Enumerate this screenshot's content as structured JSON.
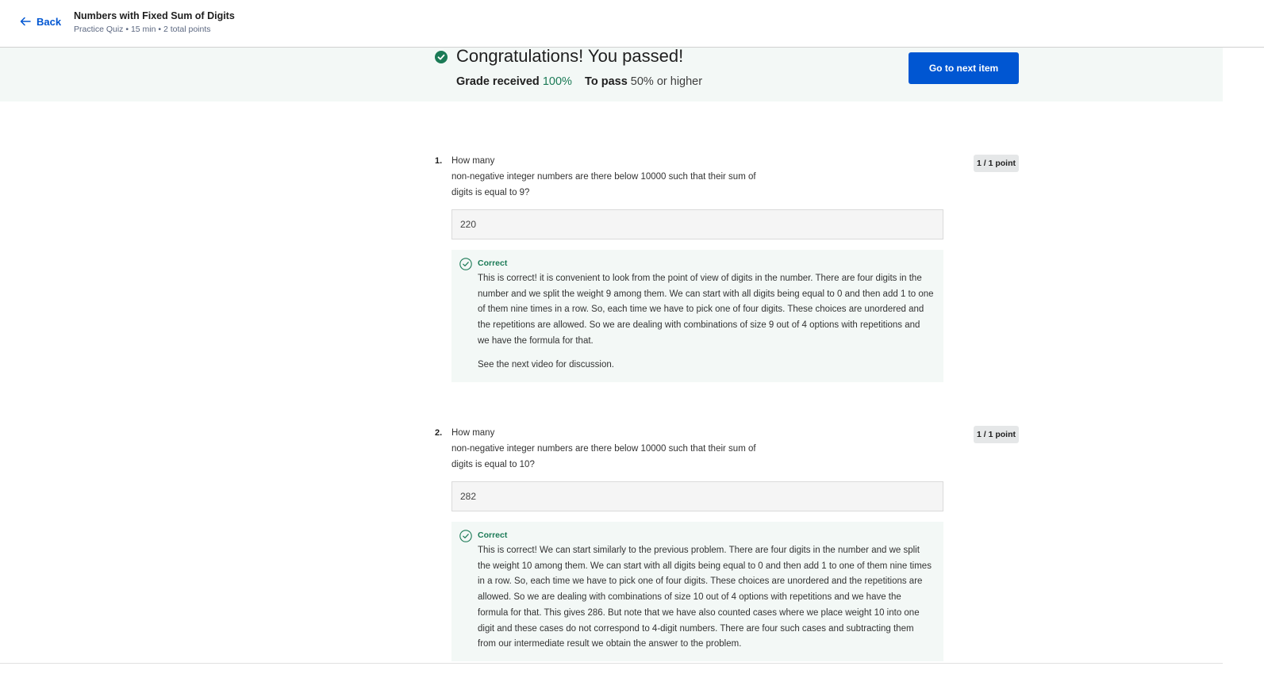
{
  "header": {
    "back_label": "Back",
    "title": "Numbers with Fixed Sum of Digits",
    "meta": "Practice Quiz • 15 min • 2 total points"
  },
  "banner": {
    "heading": "Congratulations! You passed!",
    "grade_label": "Grade received",
    "grade_value": "100%",
    "pass_label": "To pass",
    "pass_value": "50% or higher",
    "next_button": "Go to next item",
    "accent_color": "#0056d2",
    "success_color": "#1b7a56"
  },
  "questions": [
    {
      "number": "1.",
      "text_line1": "How many",
      "text_line2": "non-negative integer numbers are there below 10000 such that their sum of",
      "text_line3": "digits is equal to 9?",
      "points": "1 / 1 point",
      "answer": "220",
      "feedback_label": "Correct",
      "feedback_text": "This is correct! it is convenient to look from the point of view of digits in the number. There are four digits in the number and we split the weight 9 among them. We can start with all digits being equal to 0 and then add 1 to one of them nine times in a row. So, each time we have to pick one of four digits. These choices are unordered and the repetitions are allowed. So we are dealing with combinations of size 9 out of 4 options with repetitions and we have the formula for that.",
      "feedback_note": "See the next video for discussion."
    },
    {
      "number": "2.",
      "text_line1": "How many",
      "text_line2": "non-negative integer numbers are there below 10000 such that their sum of",
      "text_line3": "digits is equal to 10?",
      "points": "1 / 1 point",
      "answer": "282",
      "feedback_label": "Correct",
      "feedback_text": "This is correct! We can start similarly to the previous problem. There are four digits in the number and we split the weight 10 among them. We can start with all digits being equal to 0 and then add 1 to one of them nine times in a row. So, each time we have to pick one of four digits. These choices are unordered and the repetitions are allowed. So we are dealing with combinations of size 10 out of 4 options with repetitions and we have the formula for that. This gives 286. But note that we have also counted cases where we place weight 10 into one digit and these cases do not correspond to 4-digit numbers. There are four such cases and subtracting them from our intermediate result we obtain the answer to the problem."
    }
  ]
}
